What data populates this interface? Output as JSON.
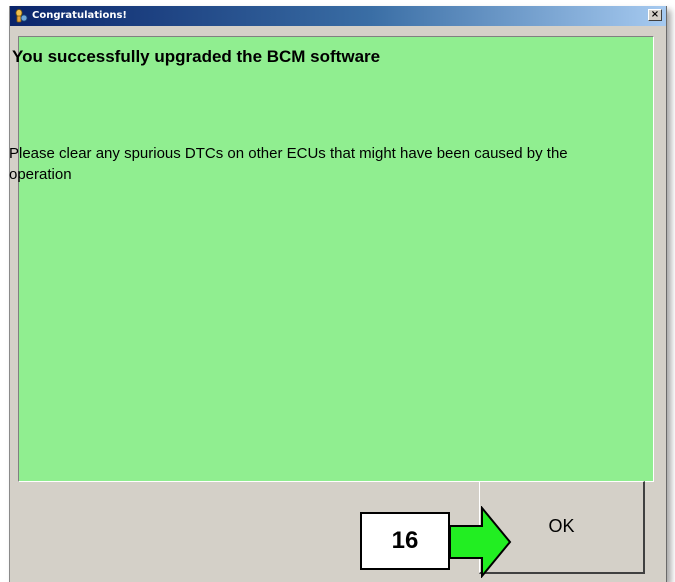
{
  "dialog": {
    "title": "Congratulations!",
    "close_label": "×"
  },
  "message": {
    "headline": "You successfully upgraded the BCM software",
    "body": "Please clear any spurious DTCs on other ECUs that might have been caused by the operation"
  },
  "buttons": {
    "ok_label": "OK"
  },
  "annotation": {
    "step_number": "16"
  },
  "colors": {
    "panel_background": "#90ee90",
    "arrow_fill": "#22ee22",
    "titlebar_start": "#0a246a",
    "titlebar_end": "#a6caf0"
  },
  "icons": {
    "title_icon": "app-icon",
    "arrow": "right-arrow-icon"
  }
}
